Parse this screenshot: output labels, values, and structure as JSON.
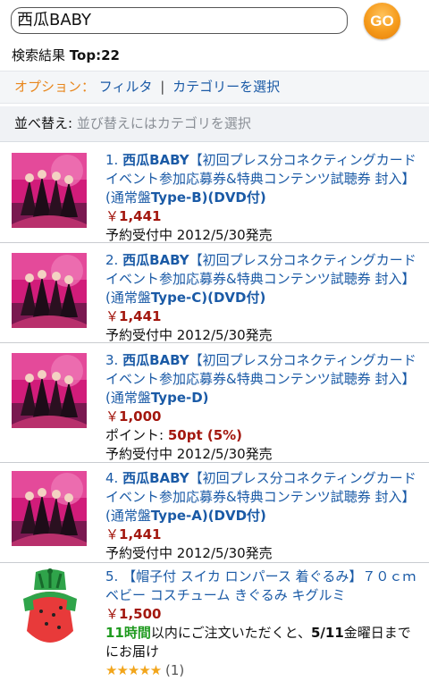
{
  "search": {
    "query": "西瓜BABY",
    "go_label": "GO"
  },
  "results_header": {
    "label": "検索結果",
    "count": "Top:22"
  },
  "options": {
    "label": "オプション：",
    "filter": "フィルタ",
    "separator": "|",
    "category": "カテゴリーを選択"
  },
  "sort": {
    "label": "並べ替え:",
    "hint": "並び替えにはカテゴリを選択"
  },
  "items": [
    {
      "num": "1.",
      "title_bold": "西瓜BABY",
      "title_rest": "【初回プレス分コネクティングカード イベント参加応募券&特典コンテンツ試聴券 封入】(通常盤",
      "title_variant": "Type-B)(DVD付)",
      "price": "1,441",
      "currency": "￥",
      "release": "予約受付中 2012/5/30発売"
    },
    {
      "num": "2.",
      "title_bold": "西瓜BABY",
      "title_rest": "【初回プレス分コネクティングカード イベント参加応募券&特典コンテンツ試聴券 封入】(通常盤",
      "title_variant": "Type-C)(DVD付)",
      "price": "1,441",
      "currency": "￥",
      "release": "予約受付中 2012/5/30発売"
    },
    {
      "num": "3.",
      "title_bold": "西瓜BABY",
      "title_rest": "【初回プレス分コネクティングカード イベント参加応募券&特典コンテンツ試聴券 封入】(通常盤",
      "title_variant": "Type-D)",
      "price": "1,000",
      "currency": "￥",
      "points_label": "ポイント:",
      "points_value": "50pt (5%)",
      "release": "予約受付中 2012/5/30発売"
    },
    {
      "num": "4.",
      "title_bold": "西瓜BABY",
      "title_rest": "【初回プレス分コネクティングカード イベント参加応募券&特典コンテンツ試聴券 封入】(通常盤",
      "title_variant": "Type-A)(DVD付)",
      "price": "1,441",
      "currency": "￥",
      "release": "予約受付中 2012/5/30発売"
    },
    {
      "num": "5.",
      "title": "【帽子付 スイカ ロンパース 着ぐるみ】７０ｃｍ ベビー コスチューム きぐるみ キグルミ",
      "price": "1,500",
      "currency": "￥",
      "ship_hours": "11時間",
      "ship_mid": "以内にご注文いただくと、",
      "ship_date": "5/11",
      "ship_end": "金曜日までにお届け",
      "rating_stars": 5,
      "review_count": "(1)"
    }
  ],
  "colors": {
    "link": "#1a5aa6",
    "price": "#a3170e",
    "option_label": "#e8861c",
    "go_button": "#f59a1b",
    "ship_green": "#1f9a1f",
    "star": "#f2a51b"
  }
}
